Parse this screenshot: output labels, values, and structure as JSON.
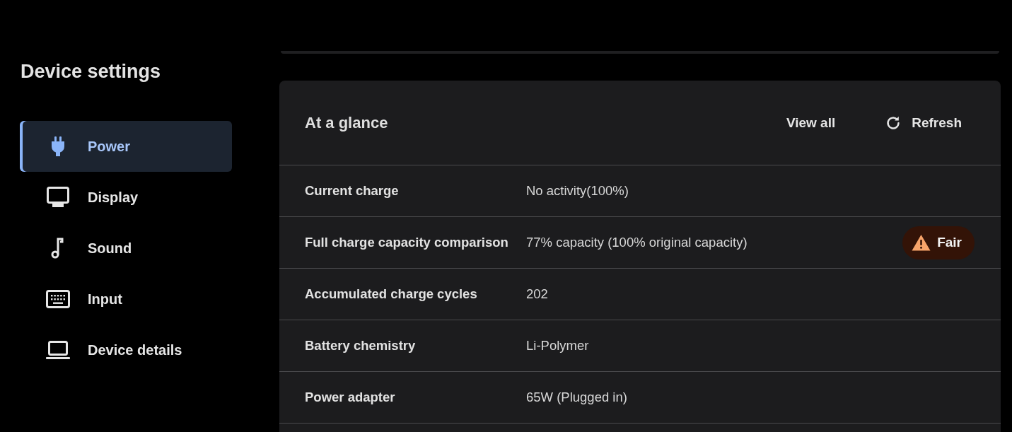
{
  "sidebar": {
    "title": "Device settings",
    "items": [
      {
        "label": "Power",
        "selected": true
      },
      {
        "label": "Display",
        "selected": false
      },
      {
        "label": "Sound",
        "selected": false
      },
      {
        "label": "Input",
        "selected": false
      },
      {
        "label": "Device details",
        "selected": false
      }
    ]
  },
  "card": {
    "title": "At a glance",
    "actions": [
      {
        "label": "View all",
        "kind": "text"
      },
      {
        "label": "Refresh",
        "kind": "refresh"
      }
    ],
    "rows": [
      {
        "label": "Current charge",
        "value": "No activity(100%)"
      },
      {
        "label": "Full charge capacity comparison",
        "value": "77% capacity (100% original capacity)",
        "badge": {
          "label": "Fair",
          "kind": "warning"
        }
      },
      {
        "label": "Accumulated charge cycles",
        "value": "202"
      },
      {
        "label": "Battery chemistry",
        "value": "Li-Polymer"
      },
      {
        "label": "Power adapter",
        "value": "65W (Plugged in)"
      }
    ]
  }
}
